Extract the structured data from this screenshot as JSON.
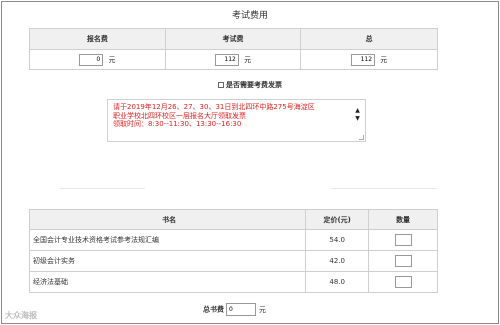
{
  "page": {
    "title": "考试费用"
  },
  "fees": {
    "headers": [
      "报名费",
      "考试费",
      "总"
    ],
    "registration": {
      "value": "0",
      "unit": "元"
    },
    "exam": {
      "value": "112",
      "unit": "元"
    },
    "total": {
      "value": "112",
      "unit": "元"
    }
  },
  "invoice": {
    "label": "是否需要考费发票",
    "checked": false
  },
  "notice": {
    "lines": [
      "请于2019年12月26、27、30、31日到北四环中路275号海淀区",
      "职业学校北四环校区一层报名大厅领取发票",
      "领取时间：8:30--11:30、13:30--16:30"
    ]
  },
  "books": {
    "headers": {
      "name": "书名",
      "price": "定价(元)",
      "qty": "数量"
    },
    "rows": [
      {
        "name": "全国会计专业技术资格考试参考法规汇编",
        "price": "54.0",
        "qty": ""
      },
      {
        "name": "初级会计实务",
        "price": "42.0",
        "qty": ""
      },
      {
        "name": "经济法基础",
        "price": "48.0",
        "qty": ""
      }
    ]
  },
  "total_books": {
    "label": "总书费",
    "value": "0",
    "unit": "元"
  },
  "watermark": {
    "text": "大众海报"
  }
}
